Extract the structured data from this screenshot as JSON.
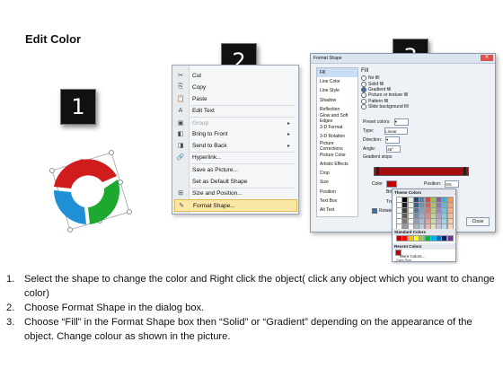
{
  "title": "Edit Color",
  "steps": [
    "1",
    "2",
    "3"
  ],
  "context_menu": {
    "items": [
      {
        "label": "Cut",
        "icon": "scissors-icon",
        "glyph": "✂",
        "disabled": false,
        "submenu": false
      },
      {
        "label": "Copy",
        "icon": "copy-icon",
        "glyph": "⎘",
        "disabled": false,
        "submenu": false
      },
      {
        "label": "Paste",
        "icon": "paste-icon",
        "glyph": "📋",
        "disabled": false,
        "submenu": false
      },
      {
        "label": "Edit Text",
        "icon": "edit-text-icon",
        "glyph": "A",
        "disabled": false,
        "submenu": false
      },
      {
        "label": "Group",
        "icon": "group-icon",
        "glyph": "▣",
        "disabled": true,
        "submenu": true
      },
      {
        "label": "Bring to Front",
        "icon": "bring-front-icon",
        "glyph": "◧",
        "disabled": false,
        "submenu": true
      },
      {
        "label": "Send to Back",
        "icon": "send-back-icon",
        "glyph": "◨",
        "disabled": false,
        "submenu": true
      },
      {
        "label": "Hyperlink...",
        "icon": "hyperlink-icon",
        "glyph": "🔗",
        "disabled": false,
        "submenu": false
      },
      {
        "label": "Save as Picture...",
        "icon": "none",
        "glyph": "",
        "disabled": false,
        "submenu": false
      },
      {
        "label": "Set as Default Shape",
        "icon": "none",
        "glyph": "",
        "disabled": false,
        "submenu": false
      },
      {
        "label": "Size and Position...",
        "icon": "size-position-icon",
        "glyph": "⊞",
        "disabled": false,
        "submenu": false
      },
      {
        "label": "Format Shape...",
        "icon": "format-shape-icon",
        "glyph": "✎",
        "disabled": false,
        "submenu": false,
        "highlighted": true
      }
    ]
  },
  "dialog": {
    "title": "Format Shape",
    "nav": [
      "Fill",
      "Line Color",
      "Line Style",
      "Shadow",
      "Reflection",
      "Glow and Soft Edges",
      "3-D Format",
      "3-D Rotation",
      "Picture Corrections",
      "Picture Color",
      "Artistic Effects",
      "Crop",
      "Size",
      "Position",
      "Text Box",
      "Alt Text"
    ],
    "selected_nav": "Fill",
    "pane_heading": "Fill",
    "options": [
      "No fill",
      "Solid fill",
      "Gradient fill",
      "Picture or texture fill",
      "Pattern fill",
      "Slide background fill"
    ],
    "selected_option": "Gradient fill",
    "preset_label": "Preset colors:",
    "type_label": "Type:",
    "type_value": "Linear",
    "direction_label": "Direction:",
    "angle_label": "Angle:",
    "angle_value": "45°",
    "stops_label": "Gradient stops",
    "color_label": "Color",
    "position_label": "Position:",
    "position_value": "0%",
    "brightness_label": "Brightness:",
    "transparency_label": "Transparency:",
    "rotate_label": "Rotate with shape",
    "close_label": "Close",
    "palette": {
      "theme_label": "Theme Colors",
      "standard_label": "Standard Colors",
      "recent_label": "Recent Colors",
      "more_label": "More Colors...",
      "tooltip": "Dark Red",
      "theme_top": [
        "#ffffff",
        "#000000",
        "#eeece1",
        "#1f497d",
        "#4f81bd",
        "#c0504d",
        "#9bbb59",
        "#8064a2",
        "#4bacc6",
        "#f79646"
      ],
      "standard": [
        "#c00000",
        "#ff0000",
        "#ffc000",
        "#ffff00",
        "#92d050",
        "#00b050",
        "#00b0f0",
        "#0070c0",
        "#002060",
        "#7030a0"
      ]
    }
  },
  "ring_colors": {
    "red": "#d01c1c",
    "blue": "#1f8fd6",
    "green": "#1fa830"
  },
  "instructions": [
    {
      "num": "1.",
      "text": "Select the shape to change the color and Right click the object( click any object which you want to change color)"
    },
    {
      "num": "2.",
      "text": "Choose Format Shape in the dialog box."
    },
    {
      "num": "3.",
      "text": "Choose “Fill” in the Format Shape box then “Solid” or “Gradient” depending on the appearance of the object. Change colour as shown in the picture."
    }
  ]
}
